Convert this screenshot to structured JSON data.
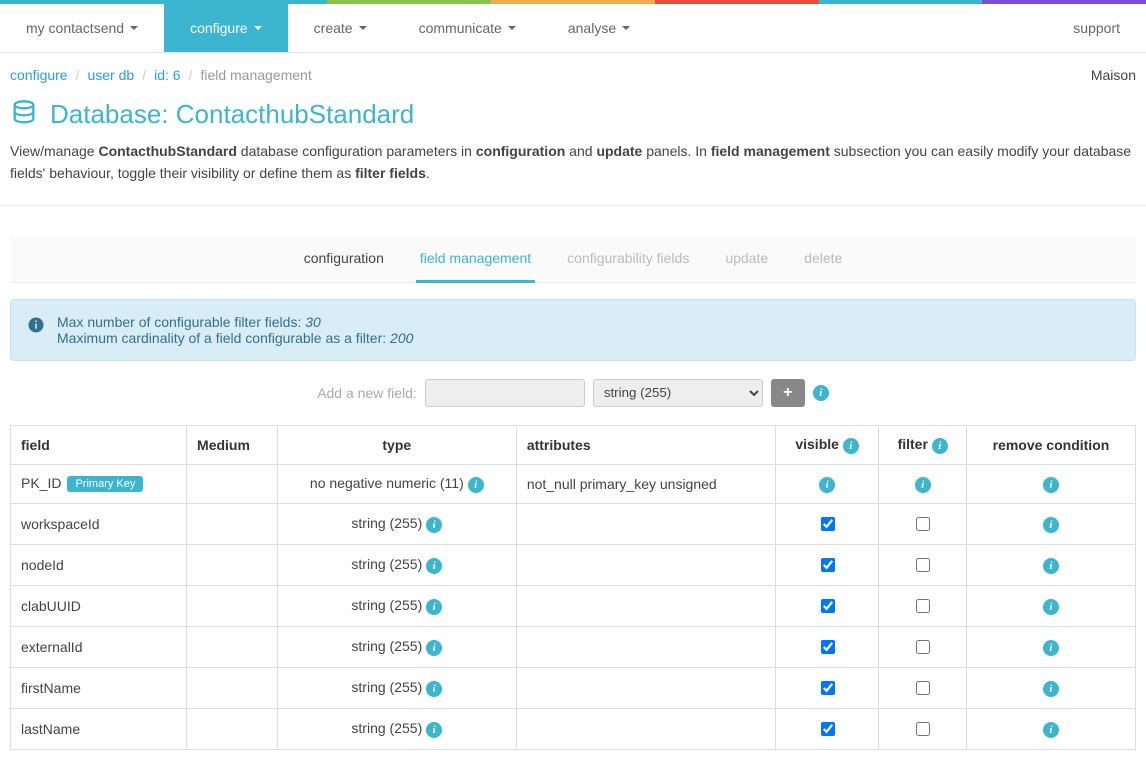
{
  "colorStrip": [
    "#3cb5d0",
    "#3cb5d0",
    "#8bc34a",
    "#f0ad4e",
    "#e74c3c",
    "#3cb5d0",
    "#7b4fd6"
  ],
  "nav": {
    "items": [
      {
        "label": "my contactsend",
        "active": false,
        "hasCaret": true
      },
      {
        "label": "configure",
        "active": true,
        "hasCaret": true
      },
      {
        "label": "create",
        "active": false,
        "hasCaret": true
      },
      {
        "label": "communicate",
        "active": false,
        "hasCaret": true
      },
      {
        "label": "analyse",
        "active": false,
        "hasCaret": true
      }
    ],
    "support": "support"
  },
  "breadcrumb": {
    "items": [
      {
        "label": "configure",
        "link": true
      },
      {
        "label": "user db",
        "link": true
      },
      {
        "label": "id: 6",
        "link": true
      },
      {
        "label": "field management",
        "link": false
      }
    ],
    "user": "Maison"
  },
  "title": {
    "prefix": "Database: ",
    "name": "ContacthubStandard"
  },
  "description": {
    "t1": "View/manage ",
    "b1": "ContacthubStandard",
    "t2": " database configuration parameters in ",
    "b2": "configuration",
    "t3": " and ",
    "b3": "update",
    "t4": " panels. In ",
    "b4": "field management",
    "t5": " subsection you can easily modify your database fields' behaviour, toggle their visibility or define them as ",
    "b5": "filter fields",
    "t6": "."
  },
  "tabs": [
    {
      "label": "configuration",
      "state": "normal"
    },
    {
      "label": "field management",
      "state": "active"
    },
    {
      "label": "configurability fields",
      "state": "disabled"
    },
    {
      "label": "update",
      "state": "disabled"
    },
    {
      "label": "delete",
      "state": "disabled"
    }
  ],
  "infoBox": {
    "line1_a": "Max number of configurable filter fields: ",
    "line1_i": "30",
    "line2_a": "Maximum cardinality of a field configurable as a filter: ",
    "line2_i": "200"
  },
  "addField": {
    "label": "Add a new field:",
    "selectValue": "string (255)"
  },
  "table": {
    "headers": {
      "field": "field",
      "medium": "Medium",
      "type": "type",
      "attributes": "attributes",
      "visible": "visible",
      "filter": "filter",
      "remove": "remove condition"
    },
    "pkBadge": "Primary Key",
    "rows": [
      {
        "field": "PK_ID",
        "pk": true,
        "medium": "",
        "type": "no negative numeric (11)",
        "attributes": "not_null primary_key unsigned",
        "visible": "info",
        "filter": "info"
      },
      {
        "field": "workspaceId",
        "pk": false,
        "medium": "",
        "type": "string (255)",
        "attributes": "",
        "visible": "checked",
        "filter": "unchecked"
      },
      {
        "field": "nodeId",
        "pk": false,
        "medium": "",
        "type": "string (255)",
        "attributes": "",
        "visible": "checked",
        "filter": "unchecked"
      },
      {
        "field": "clabUUID",
        "pk": false,
        "medium": "",
        "type": "string (255)",
        "attributes": "",
        "visible": "checked",
        "filter": "unchecked"
      },
      {
        "field": "externalId",
        "pk": false,
        "medium": "",
        "type": "string (255)",
        "attributes": "",
        "visible": "checked",
        "filter": "unchecked"
      },
      {
        "field": "firstName",
        "pk": false,
        "medium": "",
        "type": "string (255)",
        "attributes": "",
        "visible": "checked",
        "filter": "unchecked"
      },
      {
        "field": "lastName",
        "pk": false,
        "medium": "",
        "type": "string (255)",
        "attributes": "",
        "visible": "checked",
        "filter": "unchecked"
      }
    ]
  }
}
